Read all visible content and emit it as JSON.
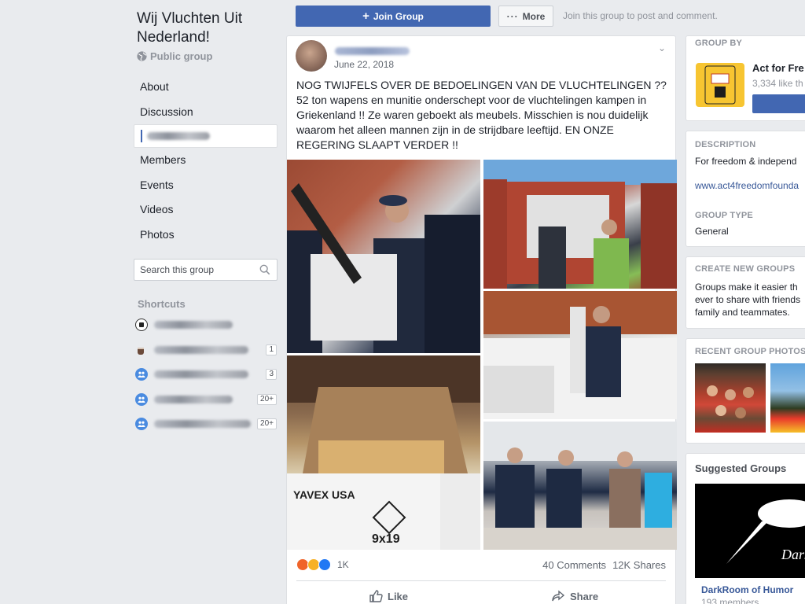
{
  "group": {
    "title": "Wij Vluchten Uit Nederland!",
    "privacy": "Public group"
  },
  "nav": {
    "items": [
      {
        "label": "About"
      },
      {
        "label": "Discussion"
      },
      {
        "label": ""
      },
      {
        "label": "Members"
      },
      {
        "label": "Events"
      },
      {
        "label": "Videos"
      },
      {
        "label": "Photos"
      }
    ]
  },
  "search": {
    "placeholder": "Search this group"
  },
  "shortcuts": {
    "title": "Shortcuts",
    "items": [
      {
        "icon": "soccer-ball-icon",
        "badge": ""
      },
      {
        "icon": "coffee-cup-icon",
        "badge": "1"
      },
      {
        "icon": "group-icon",
        "badge": "3"
      },
      {
        "icon": "group-icon",
        "badge": "20+"
      },
      {
        "icon": "group-icon",
        "badge": "20+"
      }
    ]
  },
  "actions": {
    "join_label": "Join Group",
    "more_label": "More",
    "join_note": "Join this group to post and comment."
  },
  "post": {
    "date": "June 22, 2018",
    "text": "NOG TWIJFELS OVER DE BEDOELINGEN VAN DE VLUCHTELINGEN ?? 52 ton wapens en munitie onderschept voor de vluchtelingen kampen in Griekenland !! Ze waren geboekt als meubels. Misschien is nou duidelijk waarom het alleen mannen zijn in de strijdbare leeftijd. EN ONZE REGERING SLAAPT VERDER !!",
    "reaction_count": "1K",
    "comments": "40 Comments",
    "shares": "12K Shares",
    "like_label": "Like",
    "share_label": "Share",
    "photo_box_text": "YAVEX USA",
    "photo_box_sub": "9x19"
  },
  "right": {
    "group_by": {
      "heading": "GROUP BY",
      "name": "Act for Fre",
      "likes": "3,334 like th"
    },
    "description": {
      "heading": "DESCRIPTION",
      "text": "For freedom & independ",
      "link": "www.act4freedomfounda"
    },
    "group_type": {
      "heading": "GROUP TYPE",
      "value": "General"
    },
    "create": {
      "heading": "CREATE NEW GROUPS",
      "text": "Groups make it easier th ever to share with friends family and teammates."
    },
    "recent_photos": {
      "heading": "RECENT GROUP PHOTOS"
    },
    "suggested": {
      "heading": "Suggested Groups",
      "name": "DarkRoom of Humor",
      "members": "193 members",
      "image_text": "DarkRo"
    }
  },
  "colors": {
    "brand": "#4267b2",
    "link": "#385898",
    "page_bg": "#e9ebee"
  }
}
